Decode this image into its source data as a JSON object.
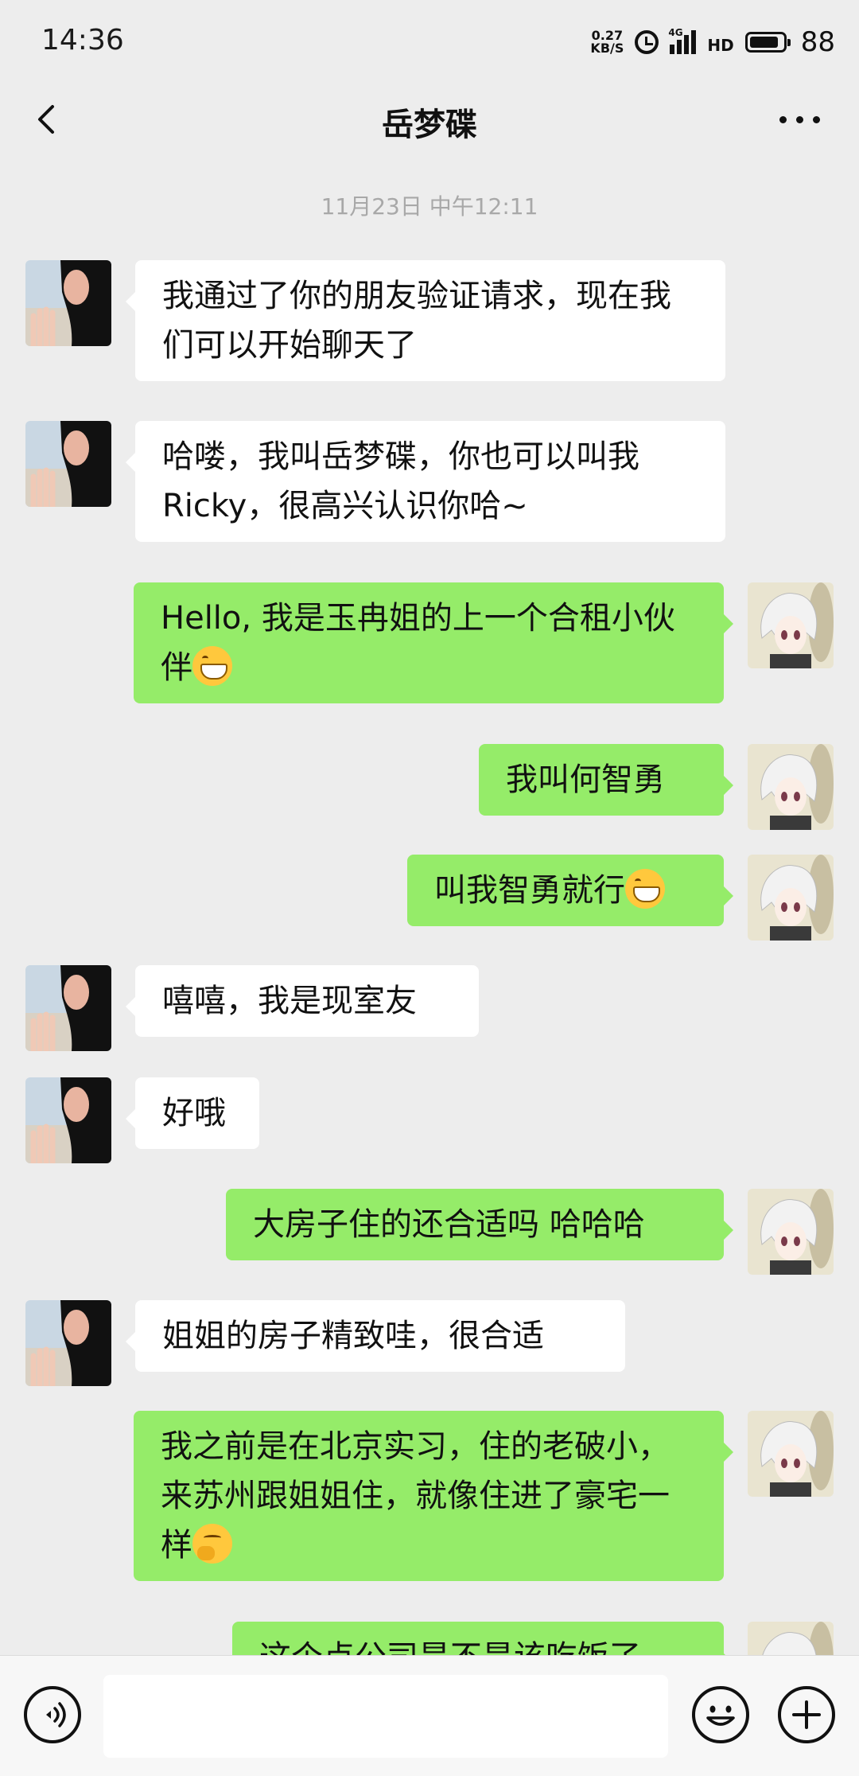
{
  "status_bar": {
    "time": "14:36",
    "net_speed_value": "0.27",
    "net_speed_unit": "KB/S",
    "network_type": "4G",
    "hd_label": "HD",
    "battery": "88",
    "battery_level": 0.88
  },
  "header": {
    "title": "岳梦碟",
    "back_icon": "chevron-left-icon",
    "more_icon": "more-dots-icon"
  },
  "chat": {
    "timestamp": "11月23日 中午12:11",
    "messages": [
      {
        "direction": "in",
        "text": "我通过了你的朋友验证请求，现在我们可以开始聊天了"
      },
      {
        "direction": "in",
        "text": "哈喽，我叫岳梦碟，你也可以叫我Ricky，很高兴认识你哈~"
      },
      {
        "direction": "out",
        "text": "Hello, 我是玉冉姐的上一个合租小伙伴",
        "emoji": "grinning-emoji"
      },
      {
        "direction": "out",
        "text": "我叫何智勇"
      },
      {
        "direction": "out",
        "text": "叫我智勇就行",
        "emoji": "grinning-emoji"
      },
      {
        "direction": "in",
        "text": "嘻嘻，我是现室友"
      },
      {
        "direction": "in",
        "text": "好哦"
      },
      {
        "direction": "out",
        "text": "大房子住的还合适吗 哈哈哈"
      },
      {
        "direction": "in",
        "text": "姐姐的房子精致哇，很合适"
      },
      {
        "direction": "out",
        "text": "我之前是在北京实习，住的老破小，来苏州跟姐姐住，就像住进了豪宅一样",
        "emoji": "thinking-emoji"
      },
      {
        "direction": "out",
        "text": "这个点公司是不是该吃饭了"
      }
    ]
  },
  "input_bar": {
    "voice_icon": "voice-icon",
    "input_value": "",
    "emoji_icon": "smiley-icon",
    "plus_icon": "plus-icon"
  },
  "colors": {
    "background": "#ededed",
    "outgoing_bubble": "#95ec69",
    "incoming_bubble": "#ffffff",
    "timestamp_text": "#a8a8a8"
  }
}
